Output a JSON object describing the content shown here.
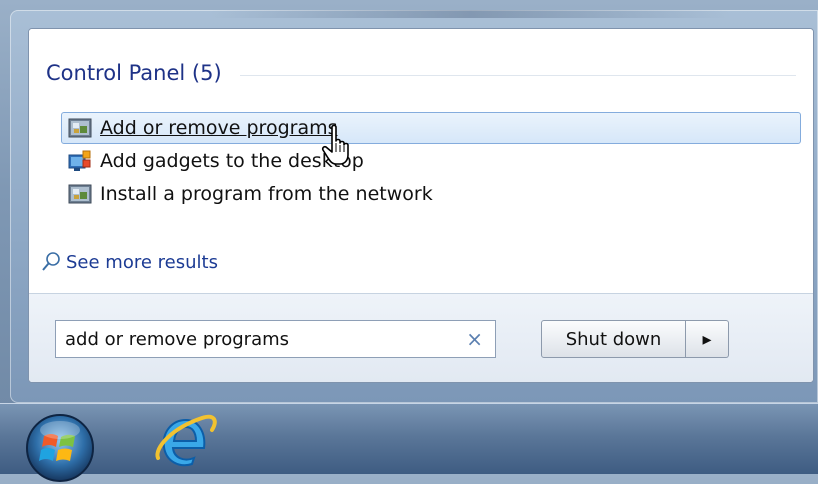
{
  "results": {
    "group_title": "Control Panel (5)",
    "items": [
      {
        "label": "Add or remove programs",
        "icon": "programs-and-features-icon",
        "selected": true
      },
      {
        "label": "Add gadgets to the desktop",
        "icon": "desktop-gadgets-icon",
        "selected": false
      },
      {
        "label": "Install a program from the network",
        "icon": "programs-and-features-icon",
        "selected": false
      }
    ],
    "see_more_label": "See more results"
  },
  "search": {
    "value": "add or remove programs",
    "clear_glyph": "×"
  },
  "shutdown": {
    "label": "Shut down",
    "arrow_glyph": "▸"
  },
  "taskbar": {
    "start_button": "windows-start-orb-icon",
    "pinned": [
      "internet-explorer-icon"
    ]
  },
  "colors": {
    "group_title": "#1e3287",
    "link": "#1c3b94",
    "selection_border": "#84acdd",
    "selection_fill": "#dbe9f9"
  }
}
